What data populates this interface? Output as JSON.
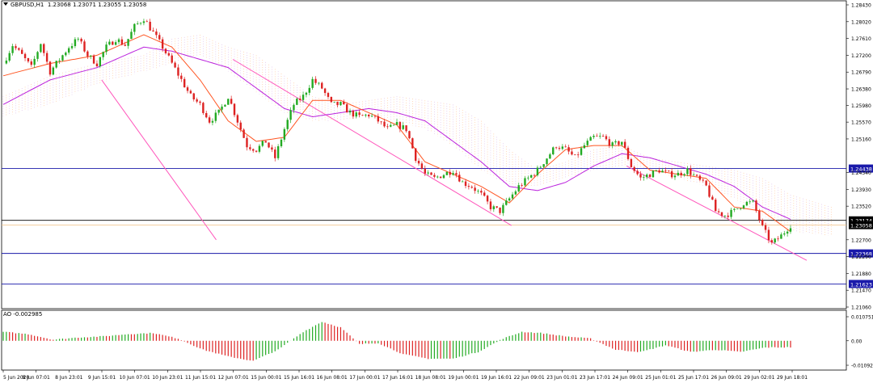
{
  "header": {
    "symbol": "GBPUSD,H1",
    "ohlc": "1.23068 1.23071 1.23055 1.23058"
  },
  "ao_header": {
    "label": "AO -0.002985"
  },
  "colors": {
    "bull": "#22aa22",
    "bear": "#dd2222",
    "ma_fast": "#ff5522",
    "ma_slow": "#bb22dd",
    "channel": "#ff55bb",
    "cloud_a": "#ffb070",
    "cloud_b": "#d0a0e0",
    "level_line": "#1a1aaa",
    "price_line": "#f0c080",
    "ao_up": "#22aa22",
    "ao_down": "#dd2222"
  },
  "chart_data": [
    {
      "type": "candlestick",
      "title": "GBPUSD,H1",
      "ylim": [
        1.2106,
        1.2843
      ],
      "y_ticks": [
        "1.28430",
        "1.28020",
        "1.27610",
        "1.27200",
        "1.26790",
        "1.26380",
        "1.25980",
        "1.25570",
        "1.25160",
        "1.24340",
        "1.23930",
        "1.23520",
        "1.22700",
        "1.22290",
        "1.21880",
        "1.21470",
        "1.21060"
      ],
      "x_ticks": [
        "5 Jun 2020",
        "8 Jun 07:01",
        "8 Jun 23:01",
        "9 Jun 15:01",
        "10 Jun 07:01",
        "10 Jun 23:01",
        "11 Jun 15:01",
        "12 Jun 07:01",
        "15 Jun 00:01",
        "15 Jun 16:01",
        "16 Jun 08:01",
        "17 Jun 00:01",
        "17 Jun 16:01",
        "18 Jun 08:01",
        "19 Jun 00:01",
        "19 Jun 16:01",
        "22 Jun 09:01",
        "23 Jun 01:01",
        "23 Jun 17:01",
        "24 Jun 09:01",
        "25 Jun 01:01",
        "25 Jun 17:01",
        "26 Jun 09:01",
        "29 Jun 02:01",
        "29 Jun 18:01"
      ],
      "horizontal_levels": [
        {
          "value": 1.24438,
          "label": "1.24438"
        },
        {
          "value": 1.23174,
          "label": "1.23174"
        },
        {
          "value": 1.22368,
          "label": "1.22368"
        },
        {
          "value": 1.21623,
          "label": "1.21623"
        }
      ],
      "current_price": {
        "value": 1.23058,
        "label": "1.23058"
      },
      "channel_lines": [
        {
          "from": [
            "9 Jun 15:01",
            1.266
          ],
          "to": [
            "11 Jun 15:01",
            1.227
          ]
        },
        {
          "from": [
            "12 Jun 07:01",
            1.271
          ],
          "to": [
            "19 Jun 16:01",
            1.2305
          ]
        },
        {
          "from": [
            "24 Jun 09:01",
            1.245
          ],
          "to": [
            "29 Jun 18:01",
            1.222
          ]
        }
      ],
      "price_path": [
        [
          0,
          1.27
        ],
        [
          3,
          1.2745
        ],
        [
          6,
          1.272
        ],
        [
          9,
          1.269
        ],
        [
          12,
          1.275
        ],
        [
          15,
          1.268
        ],
        [
          18,
          1.271
        ],
        [
          21,
          1.274
        ],
        [
          24,
          1.276
        ],
        [
          27,
          1.272
        ],
        [
          30,
          1.27
        ],
        [
          33,
          1.274
        ],
        [
          36,
          1.276
        ],
        [
          39,
          1.2745
        ],
        [
          42,
          1.279
        ],
        [
          45,
          1.281
        ],
        [
          48,
          1.2775
        ],
        [
          51,
          1.274
        ],
        [
          54,
          1.27
        ],
        [
          57,
          1.266
        ],
        [
          60,
          1.262
        ],
        [
          63,
          1.26
        ],
        [
          66,
          1.256
        ],
        [
          69,
          1.258
        ],
        [
          72,
          1.262
        ],
        [
          75,
          1.256
        ],
        [
          78,
          1.25
        ],
        [
          81,
          1.249
        ],
        [
          84,
          1.251
        ],
        [
          87,
          1.247
        ],
        [
          90,
          1.254
        ],
        [
          93,
          1.26
        ],
        [
          96,
          1.262
        ],
        [
          99,
          1.266
        ],
        [
          102,
          1.264
        ],
        [
          105,
          1.26
        ],
        [
          108,
          1.26
        ],
        [
          111,
          1.258
        ],
        [
          114,
          1.257
        ],
        [
          117,
          1.2575
        ],
        [
          120,
          1.256
        ],
        [
          123,
          1.254
        ],
        [
          126,
          1.255
        ],
        [
          129,
          1.254
        ],
        [
          132,
          1.247
        ],
        [
          135,
          1.243
        ],
        [
          138,
          1.242
        ],
        [
          141,
          1.243
        ],
        [
          144,
          1.244
        ],
        [
          147,
          1.241
        ],
        [
          150,
          1.24
        ],
        [
          153,
          1.238
        ],
        [
          156,
          1.235
        ],
        [
          159,
          1.234
        ],
        [
          162,
          1.237
        ],
        [
          165,
          1.24
        ],
        [
          168,
          1.242
        ],
        [
          171,
          1.244
        ],
        [
          174,
          1.247
        ],
        [
          177,
          1.25
        ],
        [
          180,
          1.249
        ],
        [
          183,
          1.247
        ],
        [
          186,
          1.25
        ],
        [
          189,
          1.252
        ],
        [
          192,
          1.252
        ],
        [
          195,
          1.25
        ],
        [
          198,
          1.251
        ],
        [
          201,
          1.245
        ],
        [
          204,
          1.242
        ],
        [
          207,
          1.243
        ],
        [
          210,
          1.244
        ],
        [
          213,
          1.243
        ],
        [
          216,
          1.243
        ],
        [
          219,
          1.244
        ],
        [
          222,
          1.242
        ],
        [
          225,
          1.24
        ],
        [
          228,
          1.234
        ],
        [
          231,
          1.233
        ],
        [
          234,
          1.234
        ],
        [
          237,
          1.236
        ],
        [
          240,
          1.236
        ],
        [
          243,
          1.23
        ],
        [
          246,
          1.226
        ],
        [
          249,
          1.228
        ],
        [
          252,
          1.2306
        ]
      ],
      "ma_fast": [
        [
          0,
          1.267
        ],
        [
          15,
          1.27
        ],
        [
          30,
          1.272
        ],
        [
          45,
          1.277
        ],
        [
          54,
          1.274
        ],
        [
          63,
          1.266
        ],
        [
          72,
          1.256
        ],
        [
          81,
          1.251
        ],
        [
          90,
          1.252
        ],
        [
          99,
          1.261
        ],
        [
          108,
          1.261
        ],
        [
          117,
          1.258
        ],
        [
          126,
          1.255
        ],
        [
          135,
          1.246
        ],
        [
          144,
          1.243
        ],
        [
          153,
          1.24
        ],
        [
          162,
          1.236
        ],
        [
          171,
          1.243
        ],
        [
          180,
          1.249
        ],
        [
          189,
          1.25
        ],
        [
          198,
          1.25
        ],
        [
          207,
          1.244
        ],
        [
          216,
          1.243
        ],
        [
          225,
          1.242
        ],
        [
          234,
          1.235
        ],
        [
          243,
          1.234
        ],
        [
          252,
          1.229
        ]
      ],
      "ma_slow": [
        [
          0,
          1.26
        ],
        [
          15,
          1.266
        ],
        [
          30,
          1.269
        ],
        [
          45,
          1.274
        ],
        [
          54,
          1.273
        ],
        [
          63,
          1.271
        ],
        [
          72,
          1.269
        ],
        [
          81,
          1.264
        ],
        [
          90,
          1.259
        ],
        [
          99,
          1.257
        ],
        [
          108,
          1.258
        ],
        [
          117,
          1.259
        ],
        [
          126,
          1.258
        ],
        [
          135,
          1.256
        ],
        [
          144,
          1.251
        ],
        [
          153,
          1.246
        ],
        [
          162,
          1.24
        ],
        [
          171,
          1.239
        ],
        [
          180,
          1.241
        ],
        [
          189,
          1.245
        ],
        [
          198,
          1.248
        ],
        [
          207,
          1.247
        ],
        [
          216,
          1.245
        ],
        [
          225,
          1.243
        ],
        [
          234,
          1.24
        ],
        [
          243,
          1.235
        ],
        [
          252,
          1.232
        ]
      ],
      "cloud": [
        [
          0,
          1.257,
          1.262
        ],
        [
          15,
          1.26,
          1.267
        ],
        [
          30,
          1.265,
          1.27
        ],
        [
          45,
          1.268,
          1.272
        ],
        [
          54,
          1.27,
          1.276
        ],
        [
          63,
          1.272,
          1.277
        ],
        [
          72,
          1.268,
          1.274
        ],
        [
          81,
          1.263,
          1.272
        ],
        [
          90,
          1.258,
          1.267
        ],
        [
          99,
          1.256,
          1.262
        ],
        [
          108,
          1.256,
          1.26
        ],
        [
          117,
          1.257,
          1.261
        ],
        [
          126,
          1.256,
          1.262
        ],
        [
          135,
          1.254,
          1.261
        ],
        [
          144,
          1.25,
          1.26
        ],
        [
          153,
          1.244,
          1.256
        ],
        [
          162,
          1.24,
          1.249
        ],
        [
          171,
          1.24,
          1.244
        ],
        [
          180,
          1.242,
          1.246
        ],
        [
          189,
          1.244,
          1.249
        ],
        [
          198,
          1.245,
          1.25
        ],
        [
          207,
          1.244,
          1.247
        ],
        [
          216,
          1.242,
          1.246
        ],
        [
          225,
          1.24,
          1.245
        ],
        [
          234,
          1.237,
          1.244
        ],
        [
          243,
          1.233,
          1.242
        ],
        [
          252,
          1.229,
          1.238
        ],
        [
          265,
          1.228,
          1.235
        ]
      ]
    },
    {
      "type": "bar",
      "title": "AO -0.002985",
      "ylim": [
        -0.01092,
        0.01075
      ],
      "y_ticks": [
        "0.010751",
        "0.00",
        "-0.010929"
      ],
      "series_path": [
        [
          0,
          0.004
        ],
        [
          8,
          0.003
        ],
        [
          16,
          0.0005
        ],
        [
          24,
          0.0015
        ],
        [
          32,
          0.002
        ],
        [
          40,
          0.003
        ],
        [
          48,
          0.0035
        ],
        [
          56,
          0.001
        ],
        [
          64,
          -0.004
        ],
        [
          72,
          -0.007
        ],
        [
          80,
          -0.009
        ],
        [
          88,
          -0.004
        ],
        [
          96,
          0.004
        ],
        [
          102,
          0.0085
        ],
        [
          108,
          0.006
        ],
        [
          114,
          -0.0015
        ],
        [
          120,
          -0.001
        ],
        [
          128,
          -0.006
        ],
        [
          136,
          -0.008
        ],
        [
          144,
          -0.008
        ],
        [
          152,
          -0.005
        ],
        [
          160,
          0.001
        ],
        [
          166,
          0.004
        ],
        [
          172,
          0.0035
        ],
        [
          180,
          0.002
        ],
        [
          188,
          0.001
        ],
        [
          196,
          -0.004
        ],
        [
          204,
          -0.005
        ],
        [
          212,
          -0.002
        ],
        [
          220,
          -0.005
        ],
        [
          228,
          -0.004
        ],
        [
          236,
          -0.005
        ],
        [
          244,
          -0.003
        ],
        [
          252,
          -0.0029
        ]
      ]
    }
  ]
}
